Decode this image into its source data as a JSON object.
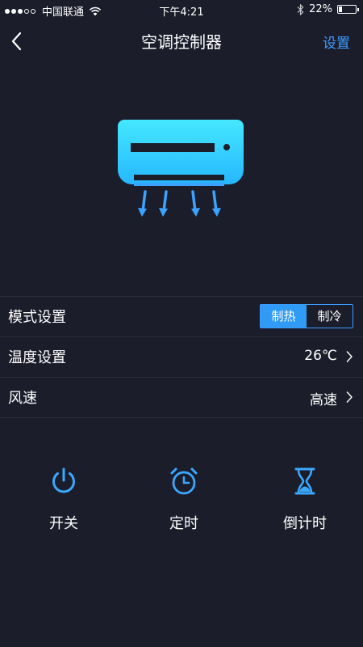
{
  "status_bar": {
    "carrier": "中国联通",
    "time": "下午4:21",
    "battery": "22%",
    "battery_level": 0.22
  },
  "nav": {
    "title": "空调控制器",
    "action": "设置"
  },
  "settings": {
    "mode": {
      "label": "模式设置",
      "options": [
        "制热",
        "制冷"
      ],
      "selected": "制热"
    },
    "temperature": {
      "label": "温度设置",
      "value": "26℃"
    },
    "fan": {
      "label": "风速",
      "value": "高速"
    }
  },
  "actions": {
    "power": {
      "label": "开关",
      "icon": "power-icon"
    },
    "timer": {
      "label": "定时",
      "icon": "alarm-clock-icon"
    },
    "countdown": {
      "label": "倒计时",
      "icon": "hourglass-icon"
    }
  },
  "colors": {
    "background": "#1b1d2b",
    "accent": "#3d9bff",
    "ac_gradient_top": "#44e8ff",
    "ac_gradient_bottom": "#26b7ff"
  }
}
